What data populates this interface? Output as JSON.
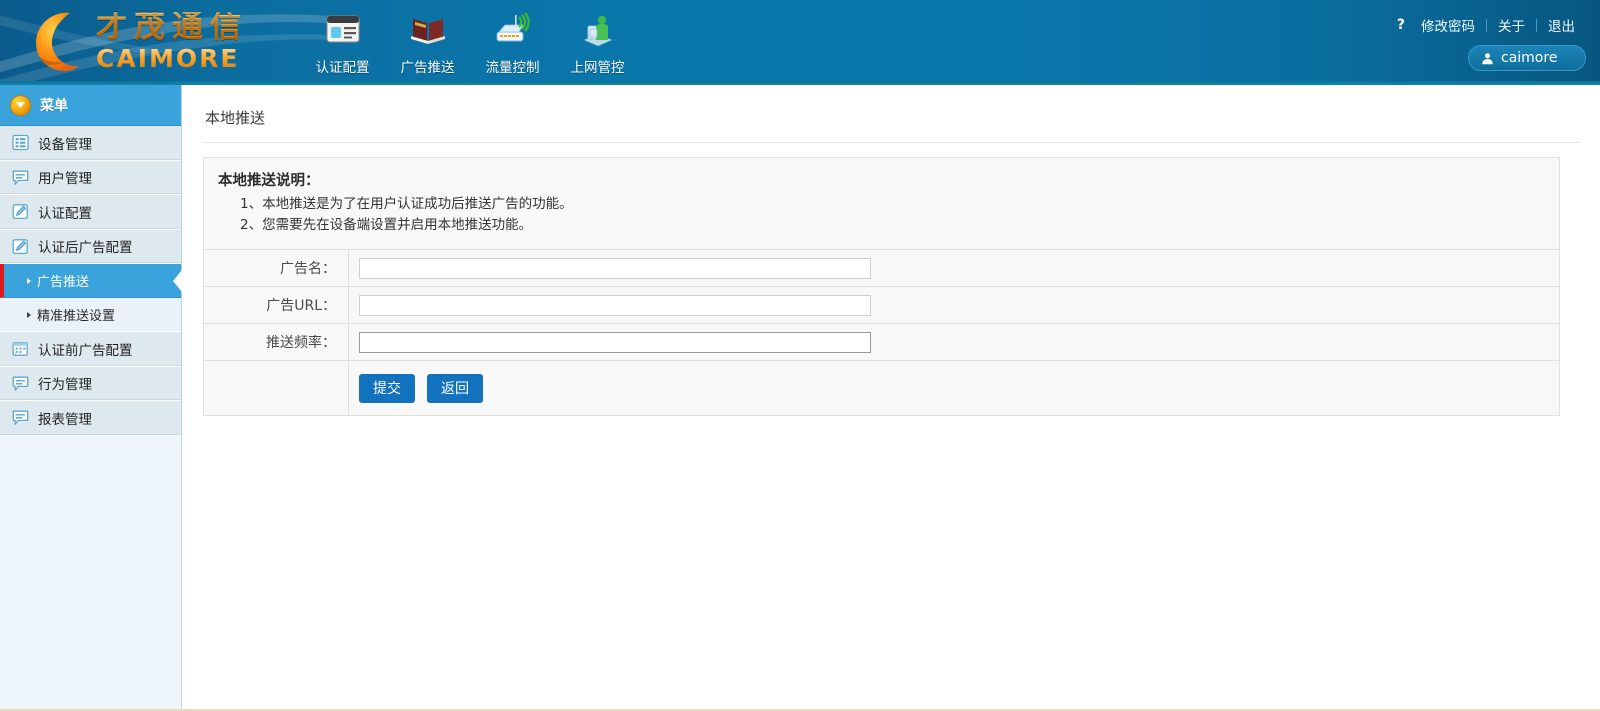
{
  "brand": {
    "name_cn": "才茂通信",
    "name_en": "CAIMORE",
    "logo_icon": "crescent-moon-logo"
  },
  "header": {
    "nav": [
      {
        "label": "认证配置",
        "icon": "auth-config-icon"
      },
      {
        "label": "广告推送",
        "icon": "ad-push-icon"
      },
      {
        "label": "流量控制",
        "icon": "traffic-control-icon"
      },
      {
        "label": "上网管控",
        "icon": "internet-control-icon"
      }
    ],
    "links": {
      "help_mark": "?",
      "change_password": "修改密码",
      "about": "关于",
      "logout": "退出"
    },
    "user": {
      "name": "caimore",
      "icon": "user-icon"
    }
  },
  "sidebar": {
    "menu_title": "菜单",
    "items": [
      {
        "label": "设备管理",
        "icon": "grid-list-icon"
      },
      {
        "label": "用户管理",
        "icon": "speech-bubble-icon"
      },
      {
        "label": "认证配置",
        "icon": "pencil-square-icon"
      },
      {
        "label": "认证后广告配置",
        "icon": "pencil-square-icon"
      }
    ],
    "subitems": [
      {
        "label": "广告推送",
        "active": true
      },
      {
        "label": "精准推送设置",
        "active": false
      }
    ],
    "items_after": [
      {
        "label": "认证前广告配置",
        "icon": "calendar-icon"
      },
      {
        "label": "行为管理",
        "icon": "speech-bubble-icon"
      },
      {
        "label": "报表管理",
        "icon": "speech-bubble-icon"
      }
    ]
  },
  "main": {
    "page_title": "本地推送",
    "note": {
      "title": "本地推送说明：",
      "lines": [
        "1、本地推送是为了在用户认证成功后推送广告的功能。",
        "2、您需要先在设备端设置并启用本地推送功能。"
      ]
    },
    "fields": [
      {
        "label": "广告名：",
        "value": "",
        "placeholder": "",
        "focused": false
      },
      {
        "label": "广告URL：",
        "value": "",
        "placeholder": "",
        "focused": false
      },
      {
        "label": "推送频率：",
        "value": "",
        "placeholder": "",
        "focused": true
      }
    ],
    "buttons": {
      "submit": "提交",
      "back": "返回"
    }
  },
  "colors": {
    "header_blue": "#0a77ab",
    "accent_blue": "#3ba3dc",
    "button_blue": "#1272bd",
    "active_red": "#e01b1b",
    "logo_orange": "#ff9a16",
    "sidebar_item": "#dde8ef"
  }
}
